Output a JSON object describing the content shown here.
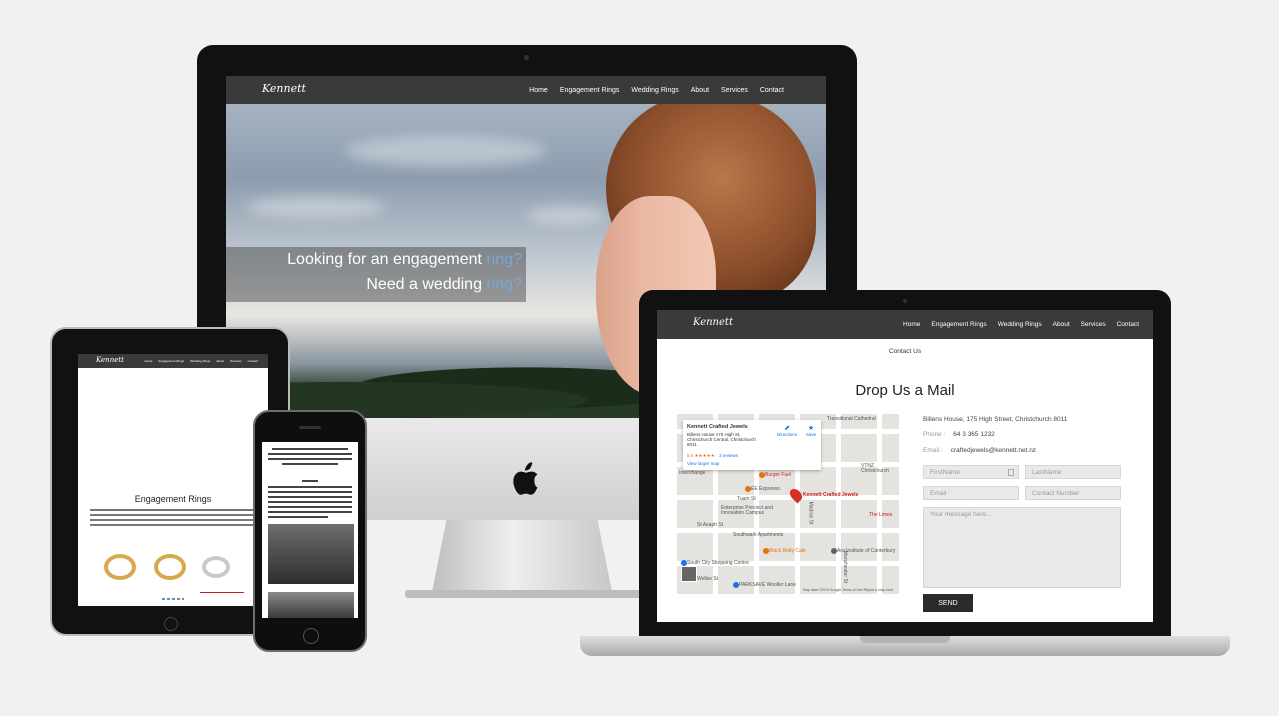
{
  "site": {
    "logo": "Kennett",
    "nav": [
      "Home",
      "Engagement Rings",
      "Wedding Rings",
      "About",
      "Services",
      "Contact"
    ]
  },
  "hero": {
    "line1": "Looking for an engagement",
    "line1_accent": "ring?",
    "line2": "Need a wedding",
    "line2_accent": "ring?"
  },
  "contact_page": {
    "breadcrumb": "Contact Us",
    "title": "Drop Us a Mail",
    "address": "Billens House, 175 High Street, Christchurch 8011",
    "phone_label": "Phone :",
    "phone": "64 3 365 1232",
    "email_label": "Email :",
    "email": "craftedjewels@kennett.net.nz",
    "form": {
      "first_name_placeholder": "FirstName",
      "last_name_placeholder": "LastName",
      "email_placeholder": "Email",
      "contact_placeholder": "Contact Number",
      "message_placeholder": "Your message here...",
      "send_label": "SEND"
    },
    "map": {
      "place_name": "Kennett Crafted Jewels",
      "place_address": "Billens House 175 High St, Christchurch Central, Christchurch 8011",
      "rating": "5.0 ★★★★★",
      "reviews": "3 reviews",
      "directions": "Directions",
      "save": "Save",
      "view_larger": "View larger map",
      "labels": [
        "Transitional Cathedral",
        "Burger Fuel",
        "EE Espresso",
        "Kennett Crafted Jewels",
        "Southwark Apartments",
        "Black Betty Cafe",
        "Ara Institute of Canterbury",
        "South City Shopping Centre",
        "PARKSAVE Wooller Lane",
        "St Asaph St",
        "Tuam St",
        "Welles St",
        "Enterprise Precinct and Innovation Campus",
        "VTNZ Christchurch",
        "The Limes",
        "Interchange",
        "Madras St",
        "Manchester St"
      ],
      "attribution": "Map data ©2019 Google  Terms of Use  Report a map error"
    }
  },
  "tablet": {
    "heading": "Engagement Rings"
  },
  "colors": {
    "nav_bg": "#3a3a3a",
    "accent": "#7aa7d3",
    "button_bg": "#2b2b2b"
  }
}
